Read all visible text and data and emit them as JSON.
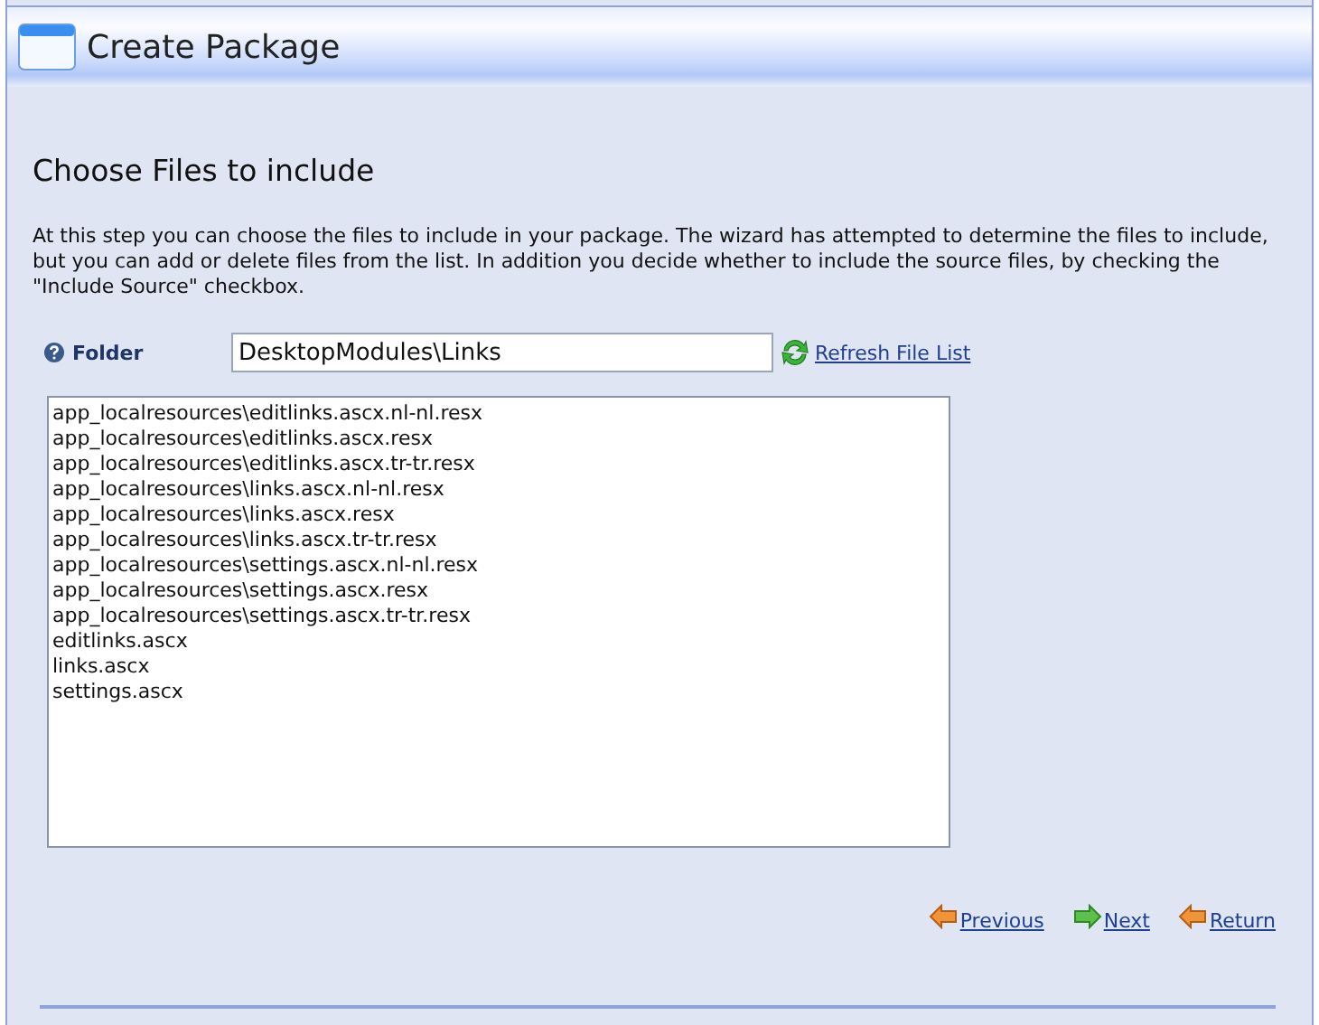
{
  "window": {
    "title": "Create Package"
  },
  "heading": "Choose Files to include",
  "description": "At this step you can choose the files to include in your package. The wizard has attempted to determine the files to include, but you can add or delete files from the list. In addition you decide whether to include the source files, by checking the \"Include Source\" checkbox.",
  "folder": {
    "label": "Folder",
    "value": "DesktopModules\\Links",
    "refresh": "Refresh File List"
  },
  "files": [
    "app_localresources\\editlinks.ascx.nl-nl.resx",
    "app_localresources\\editlinks.ascx.resx",
    "app_localresources\\editlinks.ascx.tr-tr.resx",
    "app_localresources\\links.ascx.nl-nl.resx",
    "app_localresources\\links.ascx.resx",
    "app_localresources\\links.ascx.tr-tr.resx",
    "app_localresources\\settings.ascx.nl-nl.resx",
    "app_localresources\\settings.ascx.resx",
    "app_localresources\\settings.ascx.tr-tr.resx",
    "editlinks.ascx",
    "links.ascx",
    "settings.ascx"
  ],
  "nav": [
    {
      "label": "Previous",
      "kind": "back"
    },
    {
      "label": "Next",
      "kind": "forward"
    },
    {
      "label": "Return",
      "kind": "back"
    }
  ]
}
